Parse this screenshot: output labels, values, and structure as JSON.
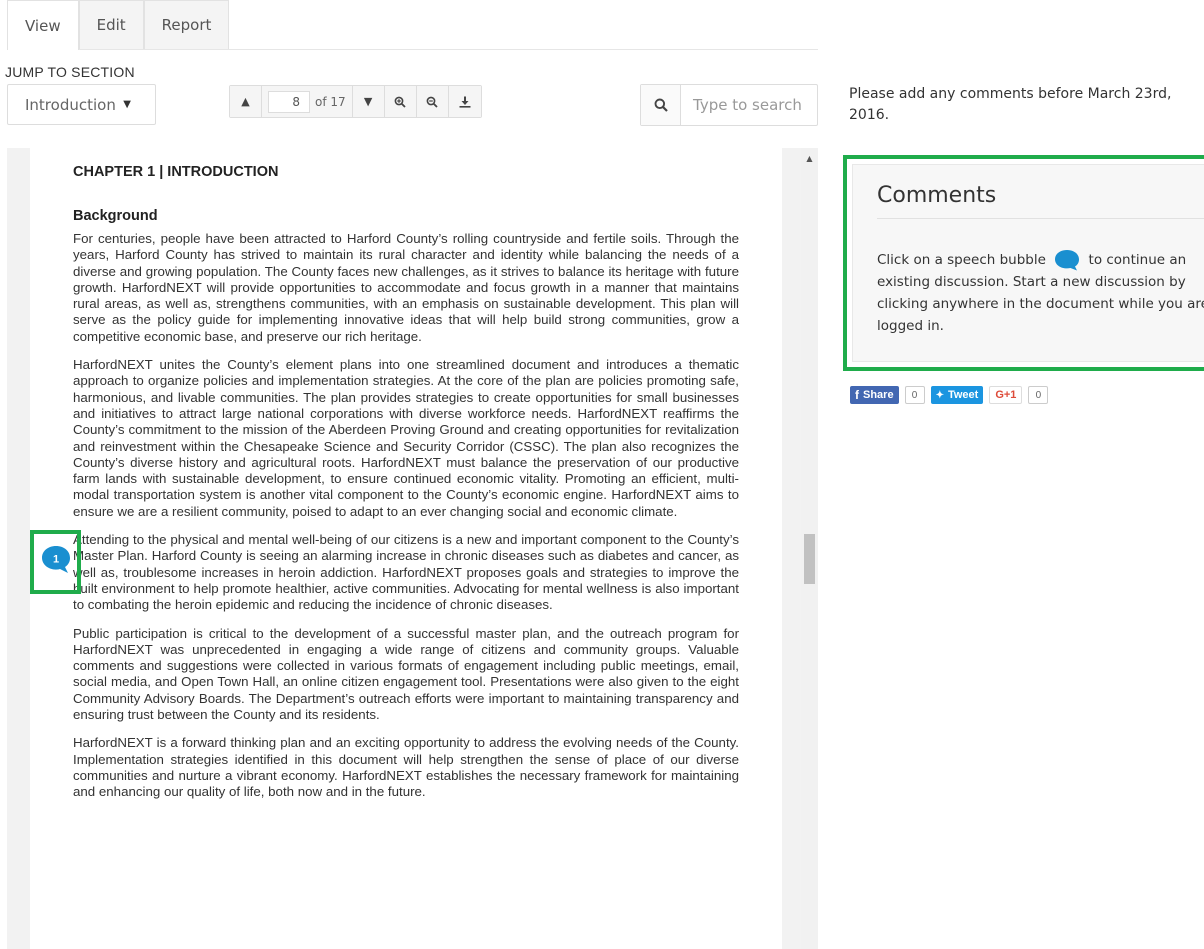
{
  "tabs": [
    {
      "label": "View"
    },
    {
      "label": "Edit"
    },
    {
      "label": "Report"
    }
  ],
  "jump": {
    "label": "JUMP TO SECTION",
    "selected": "Introduction"
  },
  "pager": {
    "current_page": "8",
    "of_text": "of 17"
  },
  "search": {
    "placeholder": "Type to search"
  },
  "document": {
    "chapter": "CHAPTER 1  |  INTRODUCTION",
    "heading": "Background",
    "paragraphs": [
      "For centuries, people have been attracted to Harford County’s rolling countryside and fertile soils. Through the years, Harford County has strived to maintain its rural character and identity while balancing the needs of a diverse and growing population. The County faces new challenges, as it strives to balance its heritage with future growth. HarfordNEXT will provide opportunities to accommodate and focus growth in a manner that maintains rural areas, as well as, strengthens communities, with an emphasis on sustainable development. This plan will serve as the policy guide for implementing innovative ideas that will help build strong communities, grow a competitive economic base, and preserve our rich heritage.",
      "HarfordNEXT unites the County’s element plans into one streamlined document and introduces a thematic approach to organize policies and implementation strategies. At the core of the plan are policies promoting safe, harmonious, and livable communities. The plan provides strategies to create opportunities for small businesses and initiatives to attract large national corporations with diverse workforce needs. HarfordNEXT reaffirms the County’s commitment to the mission of the Aberdeen Proving Ground and creating opportunities for revitalization and reinvestment within the Chesapeake Science and Security Corridor (CSSC). The plan also recognizes the County’s diverse history and agricultural roots. HarfordNEXT must balance the preservation of our productive farm lands with sustainable development, to ensure continued economic vitality. Promoting an efficient, multi-modal transportation system is another vital component to the County’s economic engine. HarfordNEXT aims to ensure we are a resilient community, poised to adapt to an ever changing social and economic climate.",
      "Attending to the physical and mental well-being of our citizens is a new and important component to the County’s Master Plan. Harford County is seeing an alarming increase in chronic diseases such as diabetes and cancer, as well as, troublesome increases in heroin addiction. HarfordNEXT proposes goals and strategies to improve the built environment to help promote healthier, active communities. Advocating for mental wellness is also important to combating the heroin epidemic and reducing the incidence of chronic diseases.",
      "Public participation is critical to the development of a successful master plan, and the outreach program for HarfordNEXT was unprecedented in engaging a wide range of citizens and community groups. Valuable comments and suggestions were collected in various formats of engagement including public meetings, email, social media, and Open Town Hall, an online citizen engagement tool. Presentations were also given to the eight Community Advisory Boards. The Department’s outreach efforts were important to maintaining transparency and ensuring trust between the County and its residents.",
      "HarfordNEXT is a forward thinking plan and an exciting opportunity to address the evolving needs of the County. Implementation strategies identified in this document will help strengthen the sense of place of our diverse communities and nurture a vibrant economy. HarfordNEXT establishes the necessary framework for maintaining and enhancing our quality of life, both now and in the future."
    ]
  },
  "comment_marker": {
    "count": "1"
  },
  "notice": "Please add any comments before March 23rd, 2016.",
  "comments": {
    "title": "Comments",
    "text_before": "Click on a speech bubble",
    "text_after": "to continue an existing discussion. Start a new discussion by clicking anywhere in the document while you are logged in."
  },
  "social": {
    "facebook_label": "Share",
    "facebook_count": "0",
    "twitter_label": "Tweet",
    "twitter_count": "0",
    "gplus_label": "G+1",
    "gplus_count": "0"
  },
  "colors": {
    "highlight": "#1fac4b",
    "bubble": "#1a8fd0",
    "facebook": "#4267b2",
    "twitter": "#1b95e0"
  }
}
